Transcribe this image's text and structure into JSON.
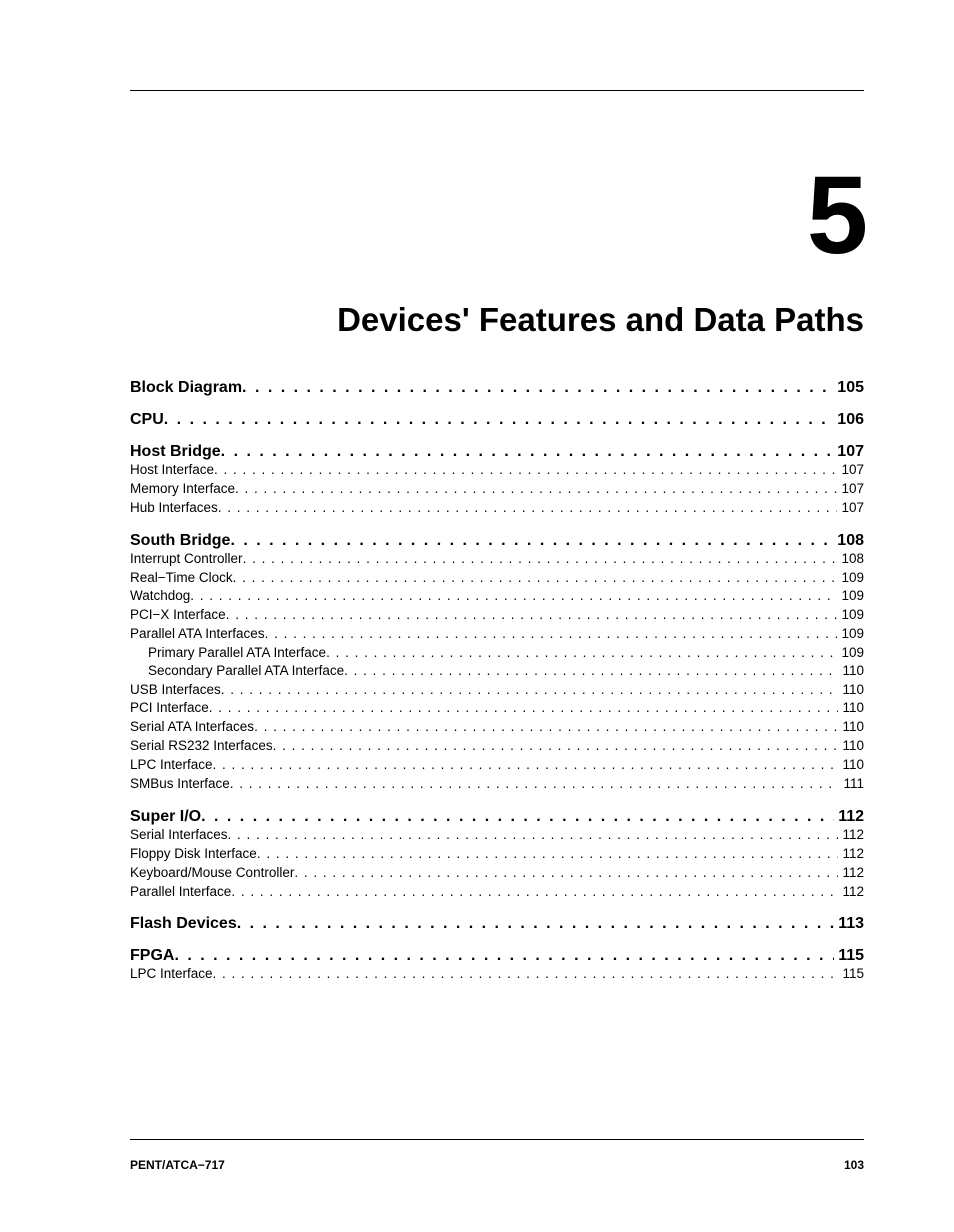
{
  "chapter_number": "5",
  "chapter_title": "Devices' Features and Data Paths",
  "toc": [
    {
      "label": "Block Diagram",
      "page": "105",
      "level": 0
    },
    {
      "label": "CPU",
      "page": "106",
      "level": 0
    },
    {
      "label": "Host Bridge",
      "page": "107",
      "level": 0
    },
    {
      "label": "Host Interface",
      "page": "107",
      "level": 1
    },
    {
      "label": "Memory Interface",
      "page": "107",
      "level": 1
    },
    {
      "label": "Hub Interfaces",
      "page": "107",
      "level": 1
    },
    {
      "label": "South Bridge",
      "page": "108",
      "level": 0
    },
    {
      "label": "Interrupt Controller",
      "page": "108",
      "level": 1
    },
    {
      "label": "Real−Time Clock",
      "page": "109",
      "level": 1
    },
    {
      "label": "Watchdog",
      "page": "109",
      "level": 1
    },
    {
      "label": "PCI−X Interface",
      "page": "109",
      "level": 1
    },
    {
      "label": "Parallel ATA Interfaces",
      "page": "109",
      "level": 1
    },
    {
      "label": "Primary Parallel ATA Interface",
      "page": "109",
      "level": 2
    },
    {
      "label": "Secondary Parallel ATA Interface",
      "page": "110",
      "level": 2
    },
    {
      "label": "USB Interfaces",
      "page": "110",
      "level": 1
    },
    {
      "label": "PCI Interface",
      "page": "110",
      "level": 1
    },
    {
      "label": "Serial ATA Interfaces",
      "page": "110",
      "level": 1
    },
    {
      "label": "Serial RS232 Interfaces",
      "page": "110",
      "level": 1
    },
    {
      "label": "LPC Interface",
      "page": "110",
      "level": 1
    },
    {
      "label": "SMBus Interface",
      "page": "111",
      "level": 1
    },
    {
      "label": "Super I/O",
      "page": "112",
      "level": 0
    },
    {
      "label": "Serial Interfaces",
      "page": "112",
      "level": 1
    },
    {
      "label": "Floppy Disk Interface",
      "page": "112",
      "level": 1
    },
    {
      "label": "Keyboard/Mouse Controller",
      "page": "112",
      "level": 1
    },
    {
      "label": "Parallel Interface",
      "page": "112",
      "level": 1
    },
    {
      "label": "Flash Devices",
      "page": "113",
      "level": 0
    },
    {
      "label": "FPGA",
      "page": "115",
      "level": 0
    },
    {
      "label": "LPC Interface",
      "page": "115",
      "level": 1
    }
  ],
  "footer_left": "PENT/ATCA−717",
  "footer_right": "103"
}
